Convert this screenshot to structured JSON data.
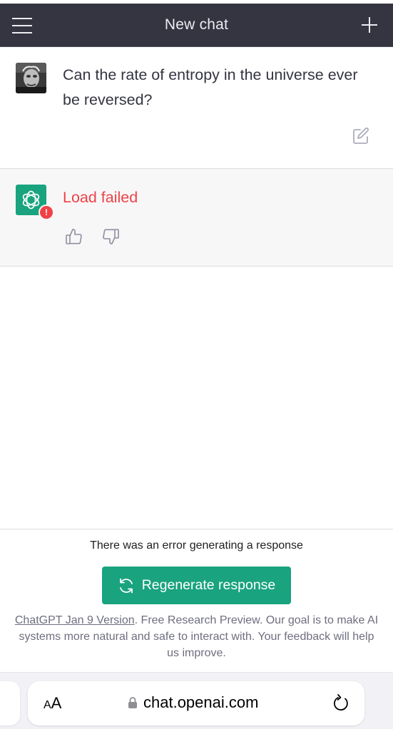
{
  "header": {
    "title": "New chat"
  },
  "conversation": {
    "user_message": "Can the rate of entropy in the universe ever be reversed?",
    "assistant_error": "Load failed",
    "error_badge": "!"
  },
  "bottom": {
    "error_notice": "There was an error generating a response",
    "regenerate_label": "Regenerate response",
    "version_link": "ChatGPT Jan 9 Version",
    "disclaimer": ". Free Research Preview. Our goal is to make AI systems more natural and safe to interact with. Your feedback will help us improve."
  },
  "browser": {
    "aa_large": "A",
    "aa_small": "A",
    "url": "chat.openai.com"
  },
  "colors": {
    "header_bg": "#343541",
    "accent_green": "#19a37f",
    "error_red": "#ef4146"
  },
  "icons": {
    "menu": "hamburger-icon",
    "new_chat": "plus-icon",
    "edit": "edit-icon",
    "thumb_up": "thumbs-up-icon",
    "thumb_down": "thumbs-down-icon",
    "regenerate": "refresh-icon",
    "lock": "lock-icon",
    "reload": "reload-icon"
  }
}
